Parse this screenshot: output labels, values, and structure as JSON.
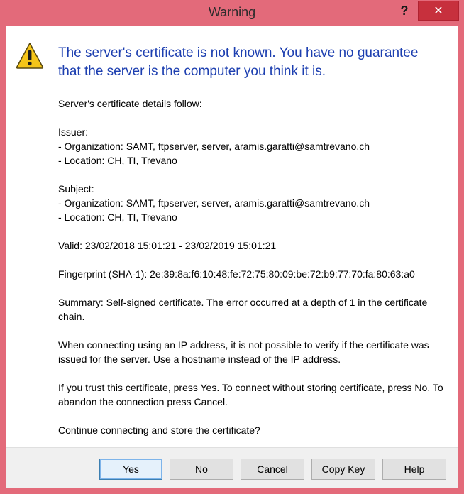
{
  "window": {
    "title": "Warning"
  },
  "titlebar": {
    "help_label": "?",
    "close_label": "✕"
  },
  "headline": "The server's certificate is not known. You have no guarantee that the server is the computer you think it is.",
  "details_intro": "Server's certificate details follow:",
  "issuer": {
    "heading": "Issuer:",
    "organization": "- Organization: SAMT, ftpserver, server, aramis.garatti@samtrevano.ch",
    "location": "- Location: CH, TI, Trevano"
  },
  "subject": {
    "heading": "Subject:",
    "organization": "- Organization: SAMT, ftpserver, server, aramis.garatti@samtrevano.ch",
    "location": "- Location: CH, TI, Trevano"
  },
  "valid": "Valid: 23/02/2018 15:01:21 - 23/02/2019 15:01:21",
  "fingerprint": "Fingerprint (SHA-1): 2e:39:8a:f6:10:48:fe:72:75:80:09:be:72:b9:77:70:fa:80:63:a0",
  "summary": "Summary: Self-signed certificate. The error occurred at a depth of 1 in the certificate chain.",
  "ip_note": "When connecting using an IP address, it is not possible to verify if the certificate was issued for the server. Use a hostname instead of the IP address.",
  "trust_note": "If you trust this certificate, press Yes. To connect without storing certificate, press No. To abandon the connection press Cancel.",
  "question": "Continue connecting and store the certificate?",
  "buttons": {
    "yes": "Yes",
    "no": "No",
    "cancel": "Cancel",
    "copy_key": "Copy Key",
    "help": "Help"
  },
  "colors": {
    "frame": "#e36a7a",
    "headline": "#1d3fb0",
    "close_button": "#c7303d",
    "warning_icon": "#f5c518"
  },
  "icons": {
    "warning": "warning-icon"
  }
}
